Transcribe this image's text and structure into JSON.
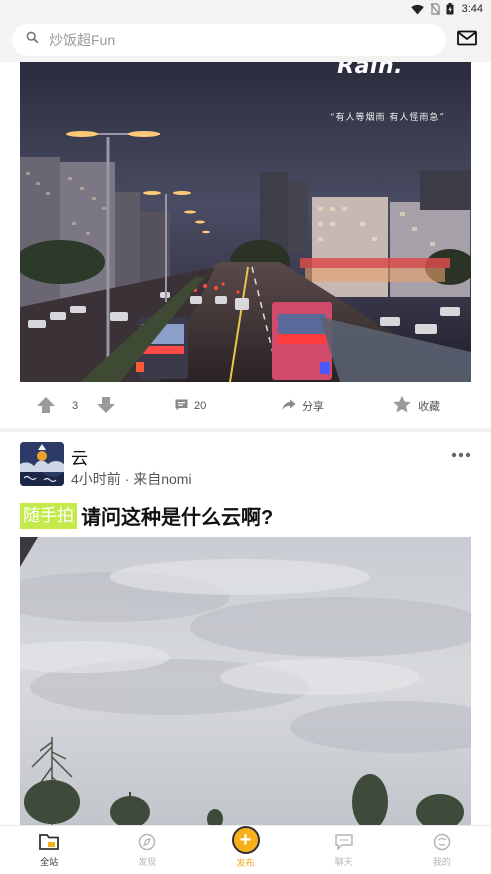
{
  "status_bar": {
    "time": "3:44"
  },
  "search": {
    "placeholder": "炒饭超Fun"
  },
  "post1": {
    "image_caption_title": "Rain.",
    "image_caption_quote": "“有人等烟雨  有人怪雨急”",
    "upvotes": "3",
    "comments": "20",
    "share_label": "分享",
    "favorite_label": "收藏"
  },
  "post2": {
    "author": "云",
    "meta": "4小时前 · 来自nomi",
    "tag": "随手拍",
    "title": "请问这种是什么云啊?",
    "more_icon": "more-dots-icon"
  },
  "bottom_nav": {
    "items": [
      {
        "label": "全站",
        "icon": "folder-icon",
        "active": true
      },
      {
        "label": "发现",
        "icon": "compass-icon",
        "active": false
      },
      {
        "label": "发布",
        "icon": "plus-icon",
        "active": false
      },
      {
        "label": "聊天",
        "icon": "chat-icon",
        "active": false
      },
      {
        "label": "我的",
        "icon": "face-icon",
        "active": false
      }
    ]
  },
  "colors": {
    "accent": "#f5b01a",
    "tag_bg": "#c3ea4a",
    "header_bg": "#f3f3f3"
  }
}
